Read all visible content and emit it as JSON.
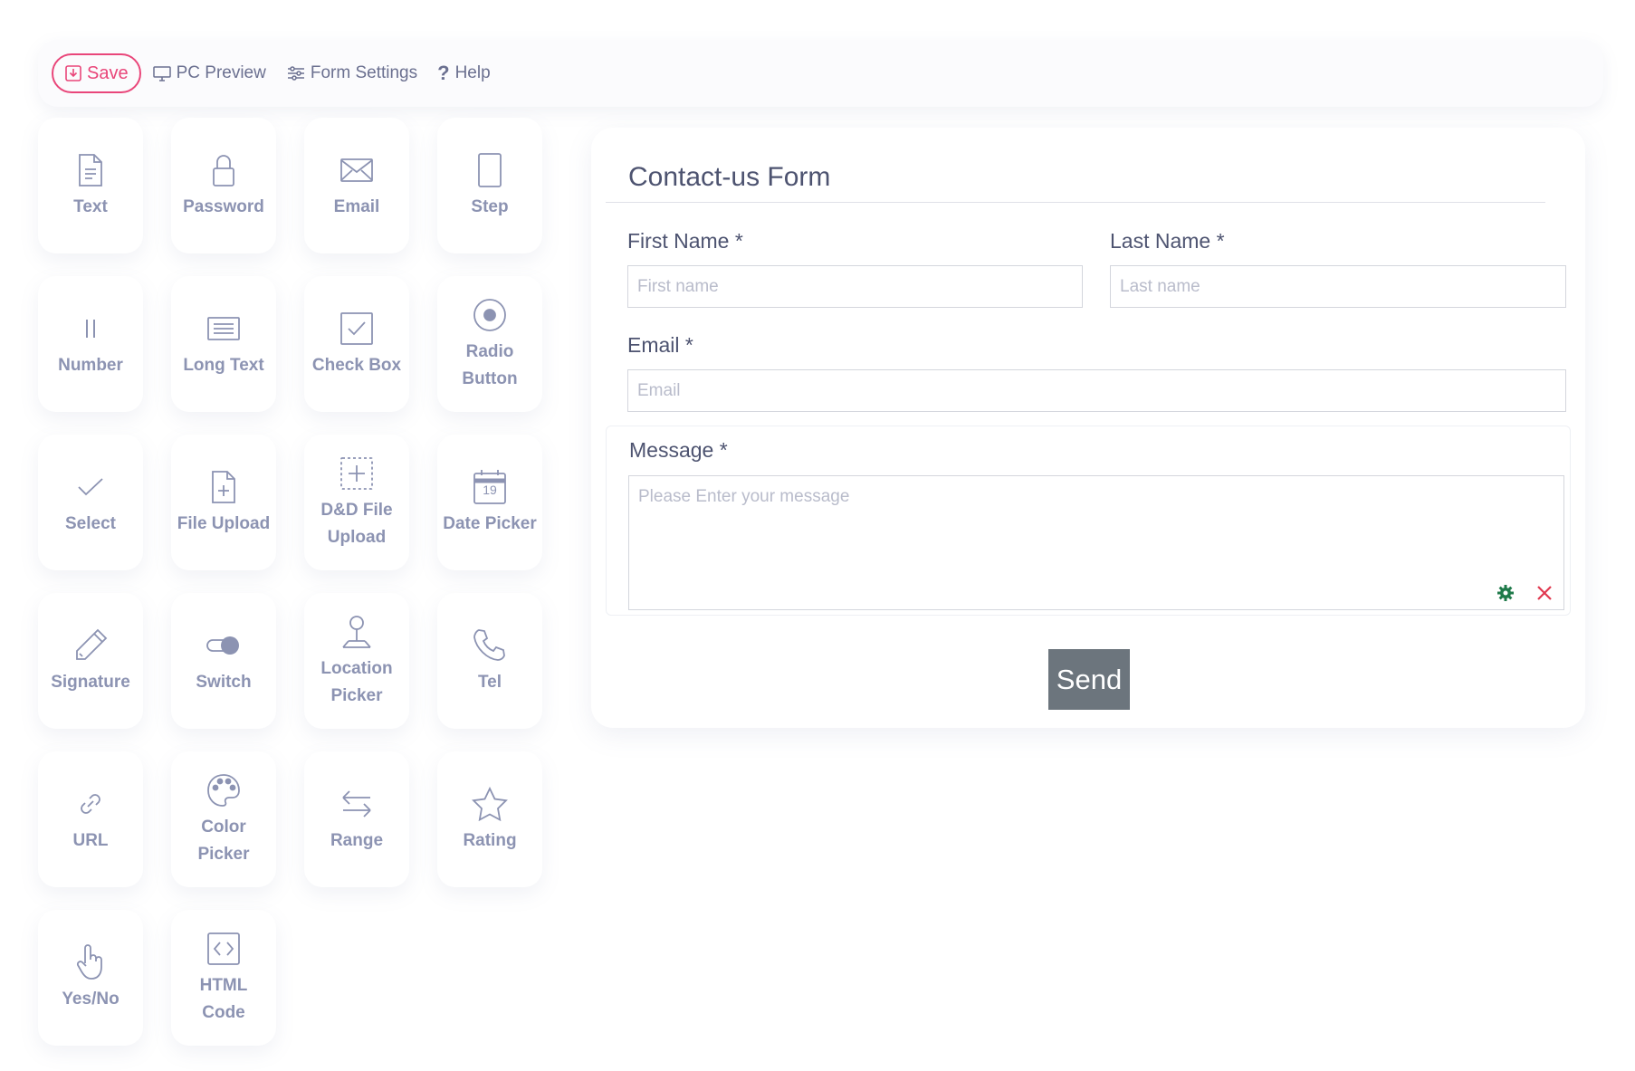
{
  "toolbar": {
    "save_label": "Save",
    "preview_label": "PC Preview",
    "settings_label": "Form Settings",
    "help_label": "Help",
    "save_color": "#e9467a"
  },
  "palette": {
    "tiles": [
      {
        "label": "Text",
        "icon": "document-icon"
      },
      {
        "label": "Password",
        "icon": "lock-icon"
      },
      {
        "label": "Email",
        "icon": "envelope-icon"
      },
      {
        "label": "Step",
        "icon": "step-icon"
      },
      {
        "label": "Number",
        "icon": "number-icon"
      },
      {
        "label": "Long Text",
        "icon": "long-text-icon"
      },
      {
        "label": "Check Box",
        "icon": "checkbox-icon"
      },
      {
        "label": "Radio Button",
        "icon": "radio-icon"
      },
      {
        "label": "Select",
        "icon": "check-mark-icon"
      },
      {
        "label": "File Upload",
        "icon": "file-upload-icon"
      },
      {
        "label": "D&D File Upload",
        "icon": "dnd-upload-icon"
      },
      {
        "label": "Date Picker",
        "icon": "calendar-icon",
        "icon_text": "19"
      },
      {
        "label": "Signature",
        "icon": "pen-icon"
      },
      {
        "label": "Switch",
        "icon": "toggle-icon"
      },
      {
        "label": "Location Picker",
        "icon": "location-icon"
      },
      {
        "label": "Tel",
        "icon": "phone-icon"
      },
      {
        "label": "URL",
        "icon": "link-icon"
      },
      {
        "label": "Color Picker",
        "icon": "palette-icon"
      },
      {
        "label": "Range",
        "icon": "range-arrows-icon"
      },
      {
        "label": "Rating",
        "icon": "star-icon"
      },
      {
        "label": "Yes/No",
        "icon": "hand-pointer-icon"
      },
      {
        "label": "HTML Code",
        "icon": "code-icon"
      }
    ]
  },
  "form": {
    "title": "Contact-us Form",
    "first_name": {
      "label": "First Name *",
      "placeholder": "First name"
    },
    "last_name": {
      "label": "Last Name *",
      "placeholder": "Last name"
    },
    "email": {
      "label": "Email *",
      "placeholder": "Email"
    },
    "message": {
      "label": "Message *",
      "placeholder": "Please Enter your message"
    },
    "send_label": "Send",
    "settings_icon_color": "#1f7a4a",
    "delete_icon_color": "#e0384f"
  }
}
